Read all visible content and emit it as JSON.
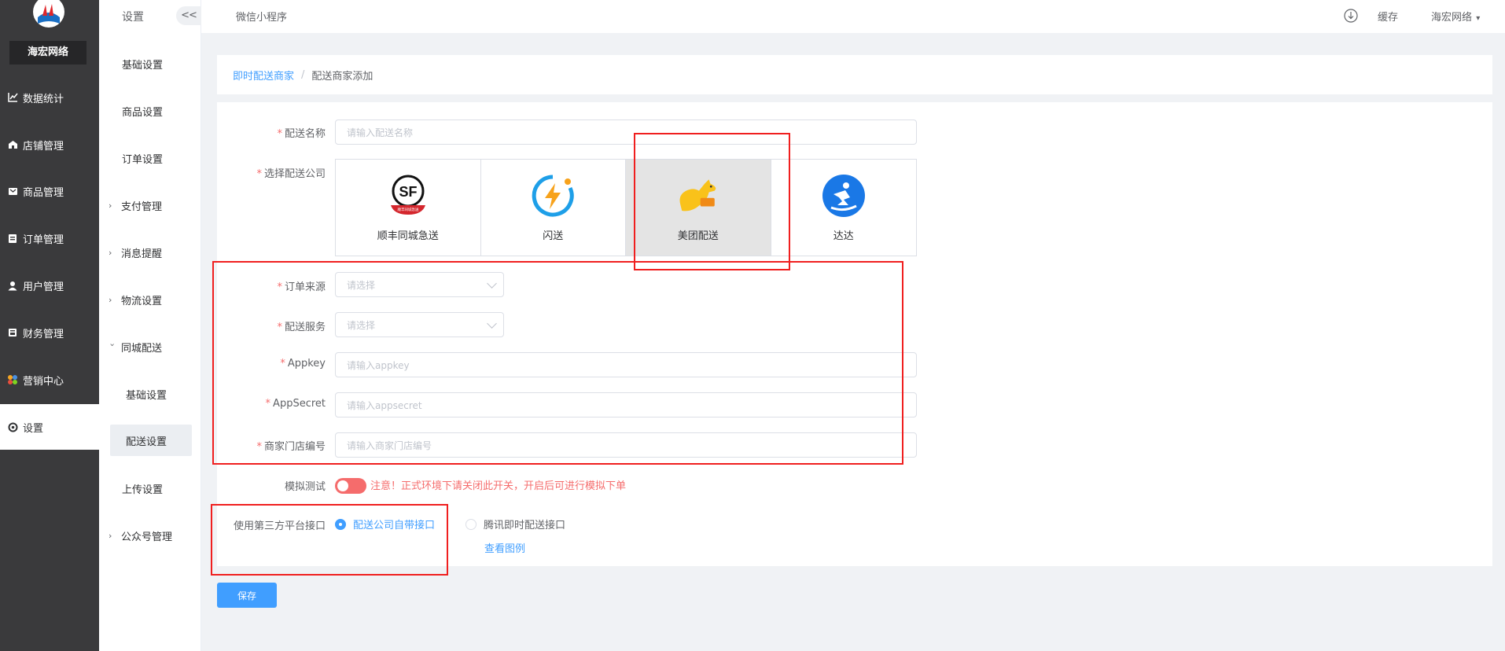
{
  "brand": {
    "name": "海宏网络"
  },
  "sidebar": {
    "items": [
      {
        "label": "数据统计",
        "icon": "line-chart-icon"
      },
      {
        "label": "店铺管理",
        "icon": "shop-icon"
      },
      {
        "label": "商品管理",
        "icon": "goods-icon"
      },
      {
        "label": "订单管理",
        "icon": "order-icon"
      },
      {
        "label": "用户管理",
        "icon": "user-icon"
      },
      {
        "label": "财务管理",
        "icon": "finance-icon"
      },
      {
        "label": "营销中心",
        "icon": "marketing-icon"
      },
      {
        "label": "设置",
        "icon": "gear-icon"
      }
    ]
  },
  "submenu": {
    "title": "设置",
    "collapse_label": "<<",
    "items": [
      {
        "label": "基础设置"
      },
      {
        "label": "商品设置"
      },
      {
        "label": "订单设置"
      },
      {
        "label": "支付管理"
      },
      {
        "label": "消息提醒"
      },
      {
        "label": "物流设置"
      },
      {
        "label": "同城配送"
      },
      {
        "label": "基础设置"
      },
      {
        "label": "配送设置"
      },
      {
        "label": "上传设置"
      },
      {
        "label": "公众号管理"
      }
    ]
  },
  "topbar": {
    "title": "微信小程序",
    "cache": "缓存",
    "user": "海宏网络"
  },
  "breadcrumb": {
    "parent": "即时配送商家",
    "separator": "/",
    "current": "配送商家添加"
  },
  "form": {
    "name": {
      "label": "配送名称",
      "placeholder": "请输入配送名称"
    },
    "company": {
      "label": "选择配送公司",
      "options": [
        {
          "name": "顺丰同城急送",
          "logo": "sf-express-logo",
          "logo_text": "SF",
          "logo_subtext": "顺丰同城急送"
        },
        {
          "name": "闪送",
          "logo": "shansong-logo"
        },
        {
          "name": "美团配送",
          "logo": "meituan-kangaroo-logo"
        },
        {
          "name": "达达",
          "logo": "dada-logo"
        }
      ],
      "selected": "美团配送"
    },
    "order_source": {
      "label": "订单来源",
      "placeholder": "请选择"
    },
    "service": {
      "label": "配送服务",
      "placeholder": "请选择"
    },
    "appkey": {
      "label": "Appkey",
      "placeholder": "请输入appkey"
    },
    "appsecret": {
      "label": "AppSecret",
      "placeholder": "请输入appsecret"
    },
    "store_no": {
      "label": "商家门店编号",
      "placeholder": "请输入商家门店编号"
    },
    "test": {
      "label": "模拟测试",
      "enabled": true,
      "warning": "注意！正式环境下请关闭此开关，开启后可进行模拟下单"
    },
    "platform": {
      "label": "使用第三方平台接口",
      "options": [
        "配送公司自带接口",
        "腾讯即时配送接口"
      ],
      "selected": "配送公司自带接口",
      "example_link": "查看图例"
    },
    "required_mark": "*"
  },
  "save_label": "保存",
  "colors": {
    "primary": "#409eff",
    "danger": "#f56c6c",
    "sidebar": "#3a3a3c",
    "annotation": "#f01f1f"
  }
}
